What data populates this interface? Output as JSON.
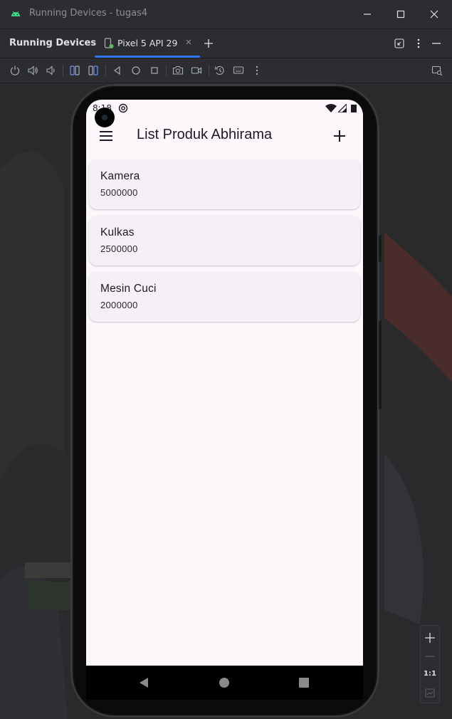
{
  "window": {
    "title": "Running Devices - tugas4",
    "controls": [
      "minimize-icon",
      "maximize-icon",
      "close-icon"
    ]
  },
  "tool_window": {
    "title": "Running Devices",
    "tabs": [
      {
        "label": "Pixel 5 API 29",
        "active": true
      }
    ],
    "accent_color": "#3574f0"
  },
  "toolbar": {
    "icons": [
      "power-icon",
      "volume-up-icon",
      "volume-down-icon",
      "rotate-left-icon",
      "rotate-right-icon",
      "back-icon",
      "home-icon",
      "overview-icon",
      "screenshot-icon",
      "screen-record-icon",
      "snapshot-icon",
      "keyboard-icon",
      "more-icon"
    ]
  },
  "device": {
    "status_time": "8:18",
    "app": {
      "title": "List Produk Abhirama",
      "products": [
        {
          "name": "Kamera",
          "price": "5000000"
        },
        {
          "name": "Kulkas",
          "price": "2500000"
        },
        {
          "name": "Mesin Cuci",
          "price": "2000000"
        }
      ],
      "background_color": "#fdf7fc",
      "card_color": "#f5f0f6"
    }
  },
  "zoom_controls": {
    "actual_size_label": "1:1"
  }
}
